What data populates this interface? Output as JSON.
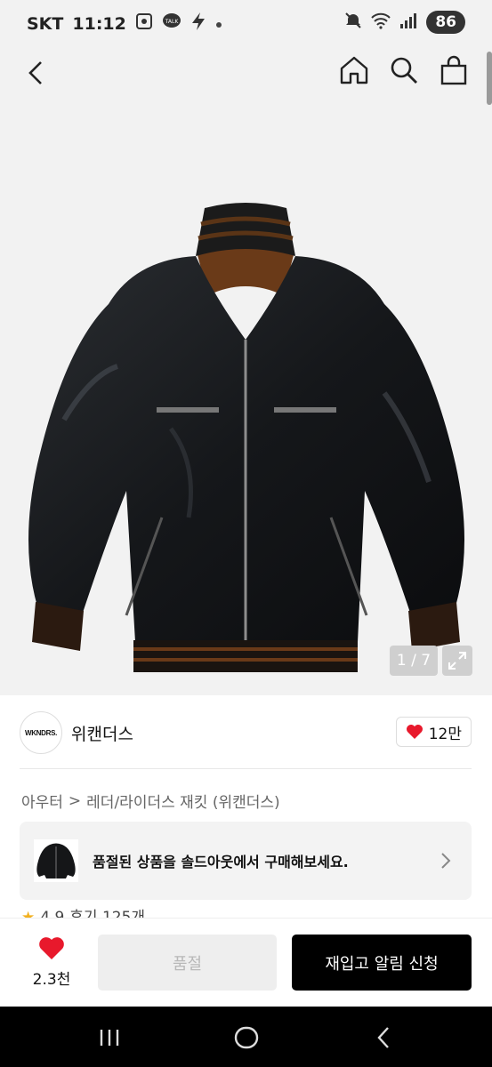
{
  "status_bar": {
    "carrier": "SKT",
    "time": "11:12",
    "battery": "86",
    "left_icons": [
      "screenshot-icon",
      "talk-icon",
      "bolt-icon",
      "dot-icon"
    ],
    "right_icons": [
      "mute-icon",
      "wifi-icon",
      "signal-icon"
    ]
  },
  "header": {
    "icons": [
      "back-icon",
      "home-icon",
      "search-icon",
      "bag-icon"
    ]
  },
  "gallery": {
    "counter": "1 / 7",
    "expand_icon": "expand-icon"
  },
  "brand": {
    "logo_text": "WKNDRS.",
    "name": "위캔더스",
    "likes": "12만"
  },
  "breadcrumb": {
    "category": "아우터",
    "separator": ">",
    "subcategory": "레더/라이더스 재킷 (위캔더스)"
  },
  "soldout_banner": {
    "text": "품절된 상품을 솔드아웃에서 구매해보세요."
  },
  "rating": {
    "score": "4.9",
    "reviews": "후기 125개"
  },
  "bottom_bar": {
    "wish_count": "2.3천",
    "soldout_label": "품절",
    "restock_label": "재입고 알림 신청"
  },
  "colors": {
    "accent_red": "#e8192c",
    "rating_star": "#f2b01e",
    "restock_bg": "#000000"
  }
}
